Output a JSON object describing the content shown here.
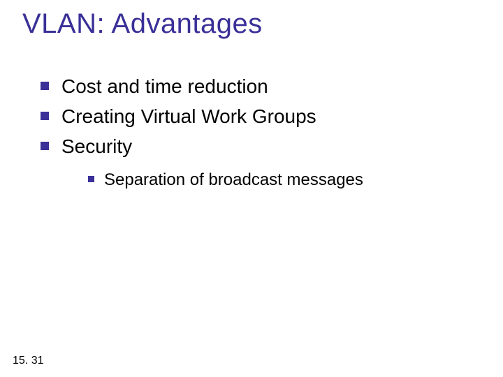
{
  "title": "VLAN: Advantages",
  "bullets": [
    {
      "text": "Cost and time reduction"
    },
    {
      "text": "Creating Virtual Work Groups"
    },
    {
      "text": "Security"
    }
  ],
  "subbullets": [
    {
      "text": "Separation of broadcast messages"
    }
  ],
  "footer": "15. 31"
}
